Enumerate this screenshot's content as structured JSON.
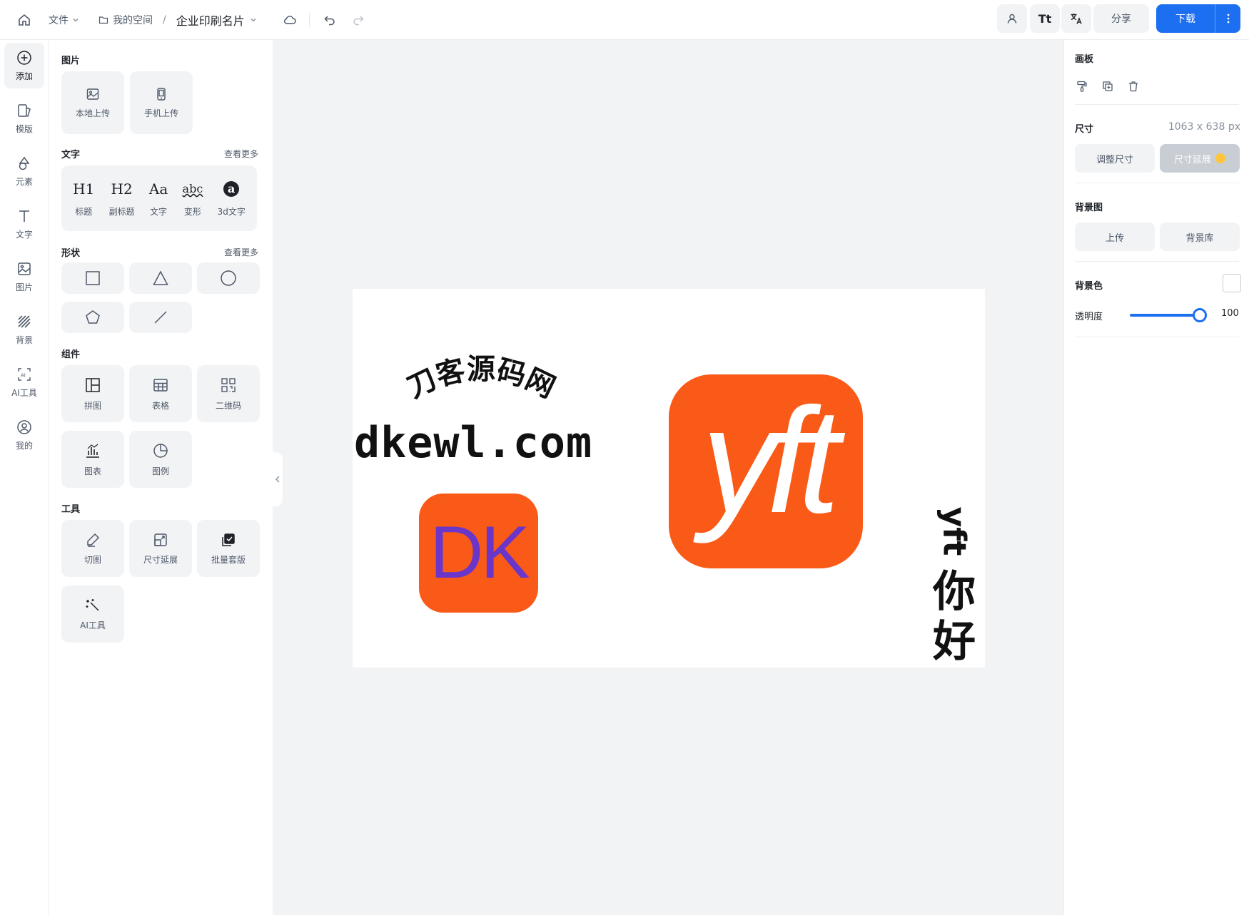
{
  "topbar": {
    "file_label": "文件",
    "breadcrumb_space": "我的空间",
    "breadcrumb_sep": "/",
    "doc_title": "企业印刷名片",
    "share_label": "分享",
    "download_label": "下载",
    "text_tool_label": "Tt"
  },
  "rail": [
    {
      "label": "添加",
      "icon": "plus-circle-icon"
    },
    {
      "label": "模版",
      "icon": "template-icon"
    },
    {
      "label": "元素",
      "icon": "shapes-icon"
    },
    {
      "label": "文字",
      "icon": "text-icon"
    },
    {
      "label": "图片",
      "icon": "image-icon"
    },
    {
      "label": "背景",
      "icon": "background-icon"
    },
    {
      "label": "AI工具",
      "icon": "ai-icon"
    },
    {
      "label": "我的",
      "icon": "user-icon"
    }
  ],
  "panel": {
    "images": {
      "title": "图片",
      "items": [
        {
          "label": "本地上传",
          "icon": "image-upload-icon"
        },
        {
          "label": "手机上传",
          "icon": "phone-icon"
        }
      ]
    },
    "text": {
      "title": "文字",
      "more": "查看更多",
      "items": [
        {
          "glyph": "H1",
          "label": "标题"
        },
        {
          "glyph": "H2",
          "label": "副标题"
        },
        {
          "glyph": "Aa",
          "label": "文字"
        },
        {
          "glyph": "abc",
          "label": "变形"
        },
        {
          "glyph": "a",
          "label": "3d文字"
        }
      ]
    },
    "shapes": {
      "title": "形状",
      "more": "查看更多"
    },
    "components": {
      "title": "组件",
      "items": [
        {
          "label": "拼图",
          "icon": "collage-icon"
        },
        {
          "label": "表格",
          "icon": "table-icon"
        },
        {
          "label": "二维码",
          "icon": "qrcode-icon"
        },
        {
          "label": "图表",
          "icon": "chart-icon"
        },
        {
          "label": "图例",
          "icon": "pie-icon"
        }
      ]
    },
    "tools": {
      "title": "工具",
      "items": [
        {
          "label": "切图",
          "icon": "cut-icon"
        },
        {
          "label": "尺寸延展",
          "icon": "resize-icon"
        },
        {
          "label": "批量套版",
          "icon": "batch-icon"
        },
        {
          "label": "AI工具",
          "icon": "magic-wand-icon"
        }
      ]
    }
  },
  "canvas": {
    "arc_text": "刀客源码网",
    "domain_text": "dkewl.com",
    "dk_logo": "DK",
    "yft_logo": "yft",
    "vertical_latin": "yft",
    "vertical_cjk": [
      "你",
      "好"
    ],
    "colors": {
      "orange": "#fa5a17",
      "purple": "#6a36c9"
    }
  },
  "right_panel": {
    "artboard_title": "画板",
    "size_title": "尺寸",
    "size_value": "1063 x 638 px",
    "resize_btn": "调整尺寸",
    "extend_btn": "尺寸延展",
    "bg_image_title": "背景图",
    "upload_btn": "上传",
    "bg_library_btn": "背景库",
    "bg_color_title": "背景色",
    "opacity_label": "透明度",
    "opacity_value": "100"
  },
  "colors": {
    "accent": "#1d6ff2"
  }
}
